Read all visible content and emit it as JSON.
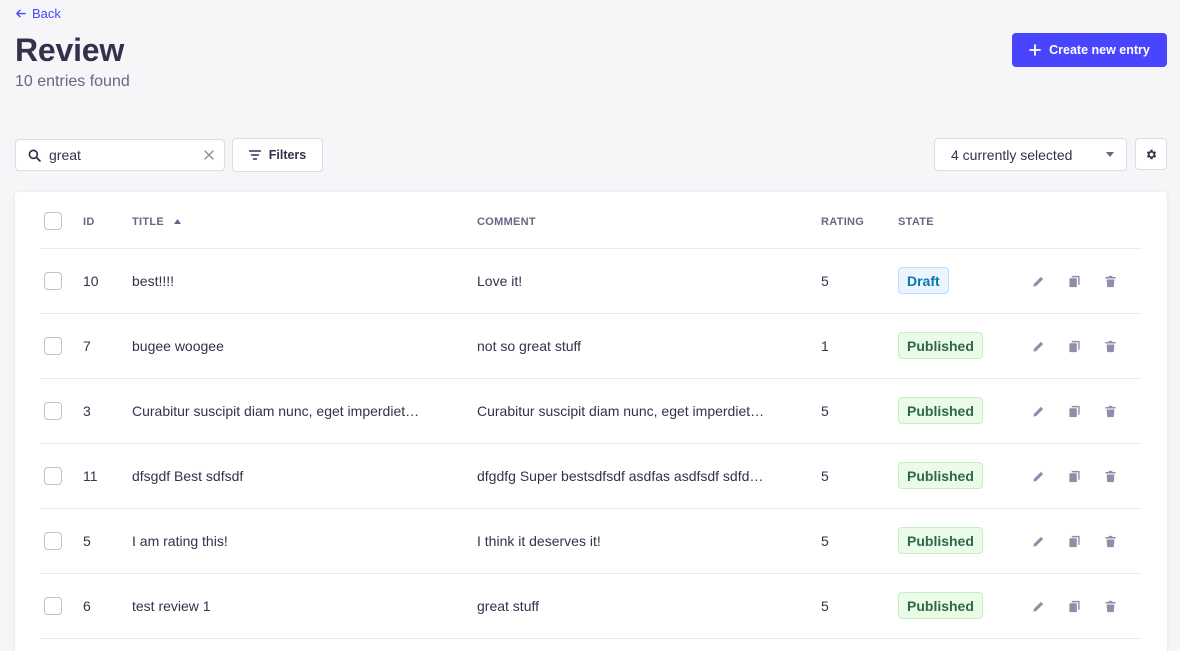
{
  "header": {
    "back_label": "Back",
    "title": "Review",
    "subtitle": "10 entries found",
    "create_label": "Create new entry"
  },
  "toolbar": {
    "search_value": "great",
    "filters_label": "Filters",
    "columns_selected": "4 currently selected"
  },
  "table": {
    "columns": [
      "ID",
      "Title",
      "Comment",
      "Rating",
      "State"
    ],
    "sorted_column": "Title",
    "rows": [
      {
        "id": "10",
        "title": "best!!!!",
        "comment": "Love it!",
        "rating": "5",
        "state": "Draft",
        "state_type": "draft"
      },
      {
        "id": "7",
        "title": "bugee woogee",
        "comment": "not so great stuff",
        "rating": "1",
        "state": "Published",
        "state_type": "published"
      },
      {
        "id": "3",
        "title": "Curabitur suscipit diam nunc, eget imperdiet…",
        "comment": "Curabitur suscipit diam nunc, eget imperdiet…",
        "rating": "5",
        "state": "Published",
        "state_type": "published"
      },
      {
        "id": "11",
        "title": "dfsgdf Best sdfsdf",
        "comment": "dfgdfg Super bestsdfsdf asdfas asdfsdf sdfd…",
        "rating": "5",
        "state": "Published",
        "state_type": "published"
      },
      {
        "id": "5",
        "title": "I am rating this!",
        "comment": "I think it deserves it!",
        "rating": "5",
        "state": "Published",
        "state_type": "published"
      },
      {
        "id": "6",
        "title": "test review 1",
        "comment": "great stuff",
        "rating": "5",
        "state": "Published",
        "state_type": "published"
      }
    ]
  },
  "icons": {
    "back": "arrow-left-icon",
    "create": "plus-icon",
    "search": "search-icon",
    "clear": "close-icon",
    "filters": "filter-icon",
    "columns_caret": "caret-down-icon",
    "settings": "gear-icon",
    "sort": "sort-up-icon",
    "edit": "pencil-icon",
    "duplicate": "duplicate-icon",
    "delete": "trash-icon"
  },
  "colors": {
    "primary": "#4945ff",
    "draft_text": "#0c75af",
    "published_text": "#2f6846",
    "muted_text": "#666687",
    "action_icon": "#8e8ea9"
  }
}
